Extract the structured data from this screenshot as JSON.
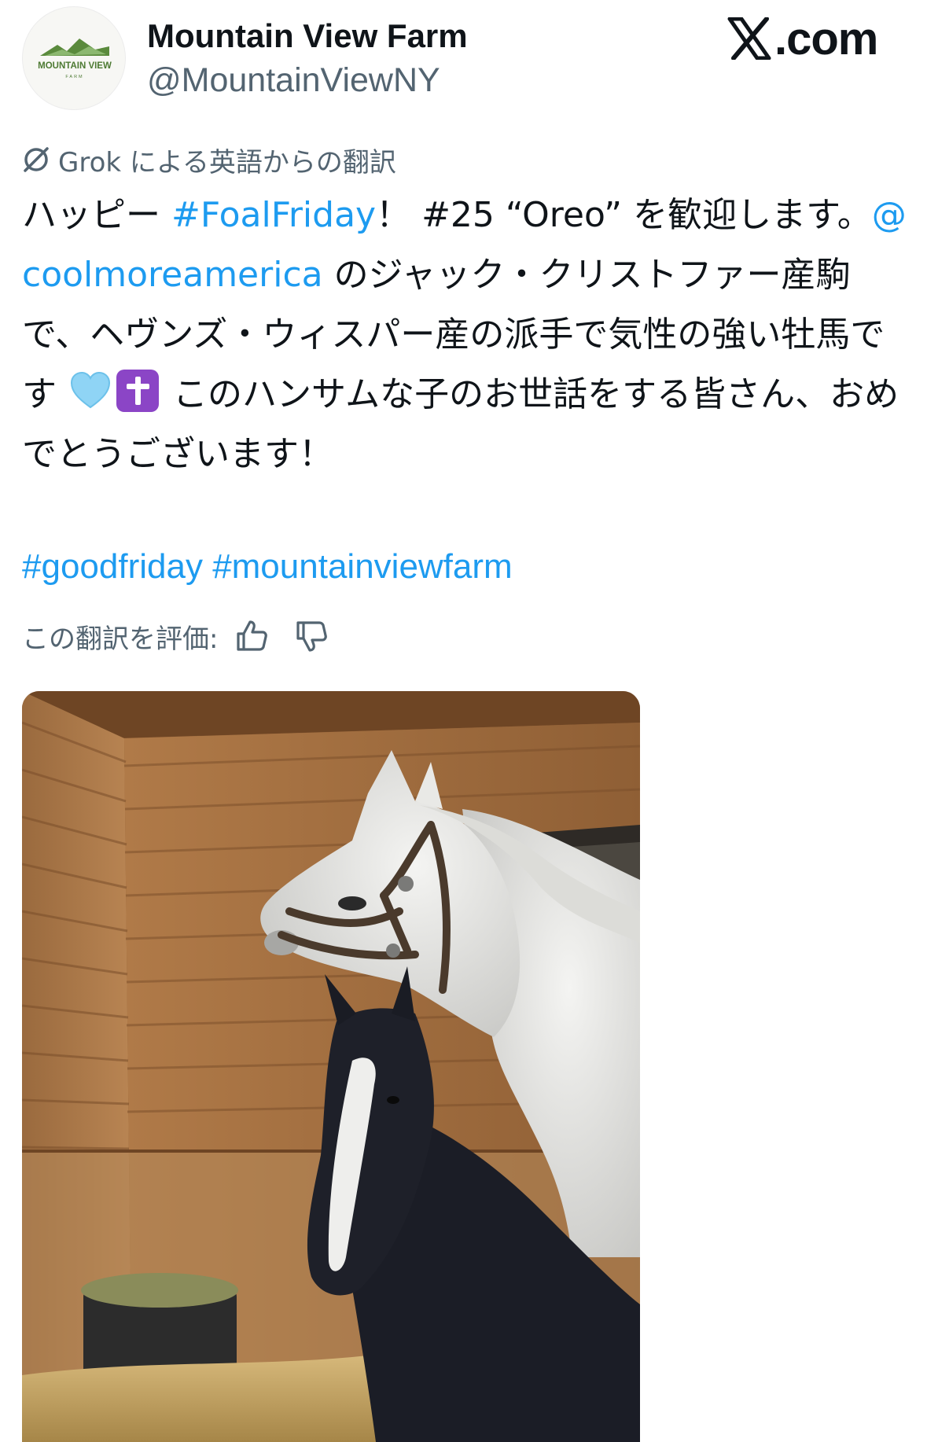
{
  "account": {
    "display_name": "Mountain View Farm",
    "handle": "@MountainViewNY",
    "avatar_text_line1": "MOUNTAIN VIEW",
    "avatar_text_line2": "FARM"
  },
  "watermark": {
    "label": ".com",
    "icon": "x-logo-icon"
  },
  "translation": {
    "icon": "grok-icon",
    "label": "Grok による英語からの翻訳"
  },
  "tweet": {
    "part1": "ハッピー ",
    "hashtag_foal": "#FoalFriday",
    "part2": "！ #25 “Oreo” を歓迎します。",
    "mention": "@coolmoreamerica",
    "part3": " のジャック・クリストファー産駒で、ヘヴンズ・ウィスパー産の派手で気性の強い牡馬です ",
    "emoji1": "light-blue-heart-icon",
    "emoji2": "latin-cross-icon",
    "part4": " このハンサムな子のお世話をする皆さん、おめでとうございます！",
    "hashtag_good": "#goodfriday",
    "hashtag_farm": "#mountainviewfarm"
  },
  "rating": {
    "label": "この翻訳を評価:",
    "up_icon": "thumbs-up-icon",
    "down_icon": "thumbs-down-icon"
  },
  "media": {
    "type": "photo",
    "subject": "white mare with dark foal in wooden stall"
  },
  "colors": {
    "link": "#1d9bf0",
    "secondary_text": "#536471",
    "primary_text": "#0f1419"
  }
}
